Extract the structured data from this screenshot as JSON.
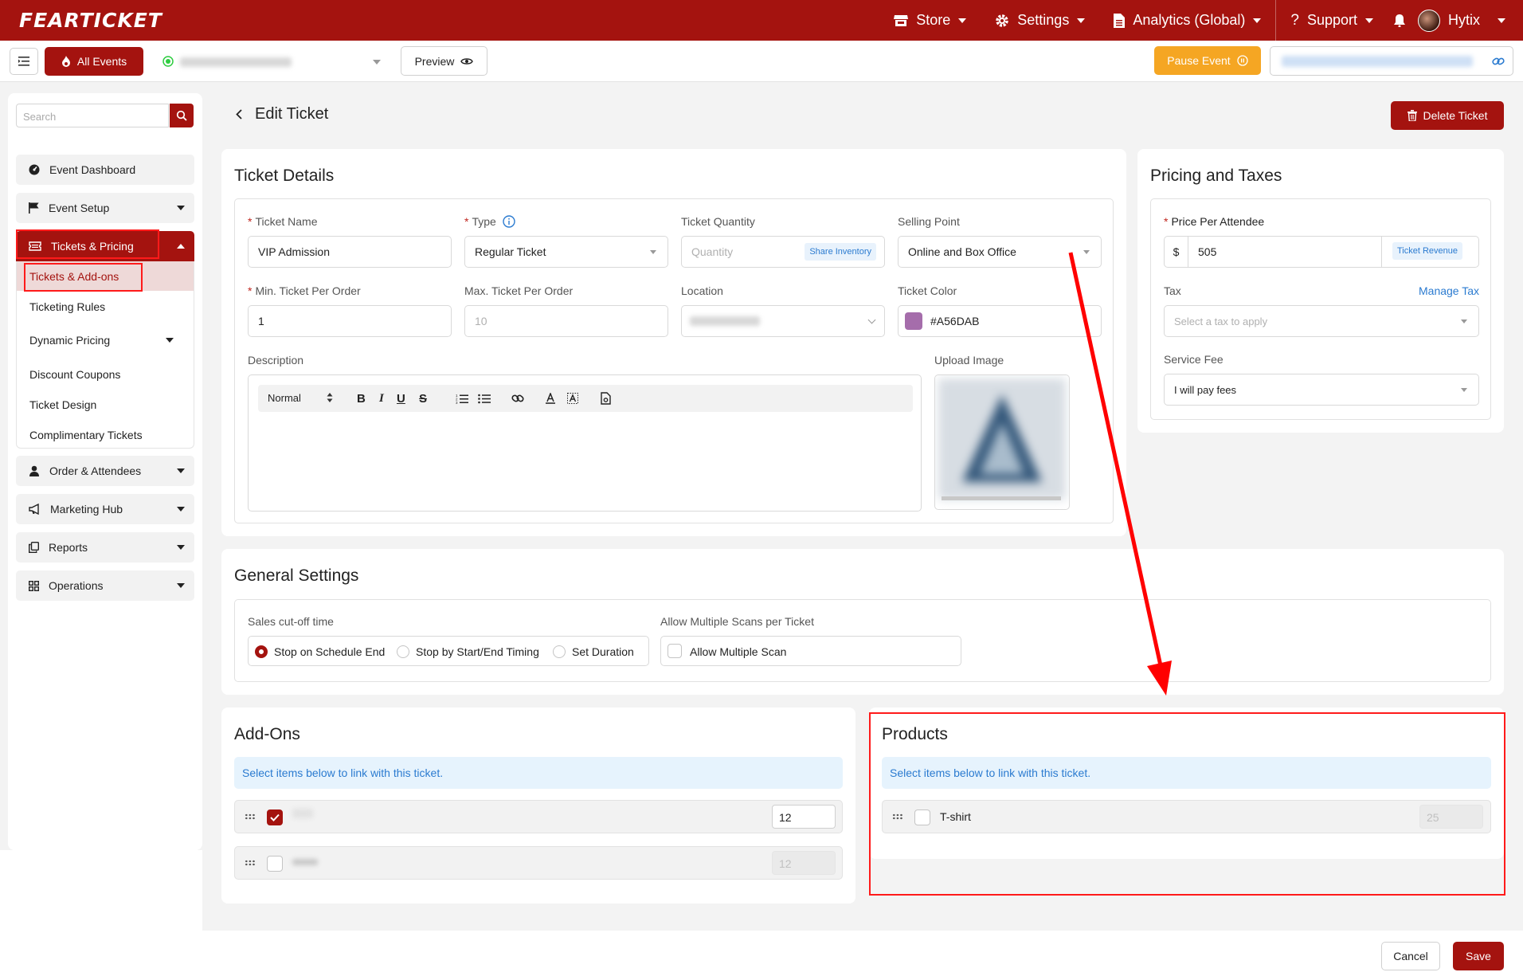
{
  "topbar": {
    "logo": "FEARTICKET",
    "store": "Store",
    "settings": "Settings",
    "analytics": "Analytics (Global)",
    "support": "Support",
    "user": "Hytix"
  },
  "subbar": {
    "all_events": "All Events",
    "preview": "Preview",
    "pause_event": "Pause Event"
  },
  "sidebar": {
    "search_placeholder": "Search",
    "items": {
      "event_dashboard": "Event Dashboard",
      "event_setup": "Event Setup",
      "tickets_pricing": "Tickets & Pricing",
      "order_attendees": "Order & Attendees",
      "marketing_hub": "Marketing Hub",
      "reports": "Reports",
      "operations": "Operations"
    },
    "sub_items": {
      "tickets_addons": "Tickets & Add-ons",
      "ticketing_rules": "Ticketing Rules",
      "dynamic_pricing": "Dynamic Pricing",
      "discount_coupons": "Discount Coupons",
      "ticket_design": "Ticket Design",
      "complimentary_tickets": "Complimentary Tickets"
    }
  },
  "page": {
    "title": "Edit Ticket",
    "delete_ticket": "Delete Ticket"
  },
  "ticket_details": {
    "title": "Ticket Details",
    "ticket_name_label": "Ticket Name",
    "ticket_name_value": "VIP Admission",
    "type_label": "Type",
    "type_value": "Regular Ticket",
    "quantity_label": "Ticket Quantity",
    "quantity_placeholder": "Quantity",
    "share_inventory": "Share Inventory",
    "selling_point_label": "Selling Point",
    "selling_point_value": "Online and Box Office",
    "min_label": "Min. Ticket Per Order",
    "min_value": "1",
    "max_label": "Max. Ticket Per Order",
    "max_placeholder": "10",
    "location_label": "Location",
    "color_label": "Ticket Color",
    "color_value": "#A56DAB",
    "swatch_color": "#A56DAB",
    "description_label": "Description",
    "upload_label": "Upload Image",
    "format_select": "Normal"
  },
  "pricing": {
    "title": "Pricing and Taxes",
    "price_label": "Price Per Attendee",
    "currency": "$",
    "price_value": "505",
    "ticket_revenue": "Ticket Revenue",
    "tax_label": "Tax",
    "manage_tax": "Manage Tax",
    "tax_placeholder": "Select a tax to apply",
    "service_fee_label": "Service Fee",
    "service_fee_value": "I will pay fees"
  },
  "general": {
    "title": "General Settings",
    "cutoff_label": "Sales cut-off time",
    "options": [
      "Stop on Schedule End",
      "Stop by Start/End Timing",
      "Set Duration"
    ],
    "multi_scan_label": "Allow Multiple Scans per Ticket",
    "multi_scan_option": "Allow Multiple Scan"
  },
  "addons": {
    "title": "Add-Ons",
    "info": "Select items below to link with this ticket.",
    "rows": [
      {
        "qty": "12",
        "checked": true
      },
      {
        "qty": "12",
        "checked": false
      }
    ]
  },
  "products": {
    "title": "Products",
    "info": "Select items below to link with this ticket.",
    "rows": [
      {
        "name": "T-shirt",
        "qty": "25",
        "checked": false
      }
    ]
  },
  "footer": {
    "cancel": "Cancel",
    "save": "Save"
  },
  "colors": {
    "brand": "#a4130f",
    "pause": "#f5a623",
    "annotation": "#ff0000"
  }
}
